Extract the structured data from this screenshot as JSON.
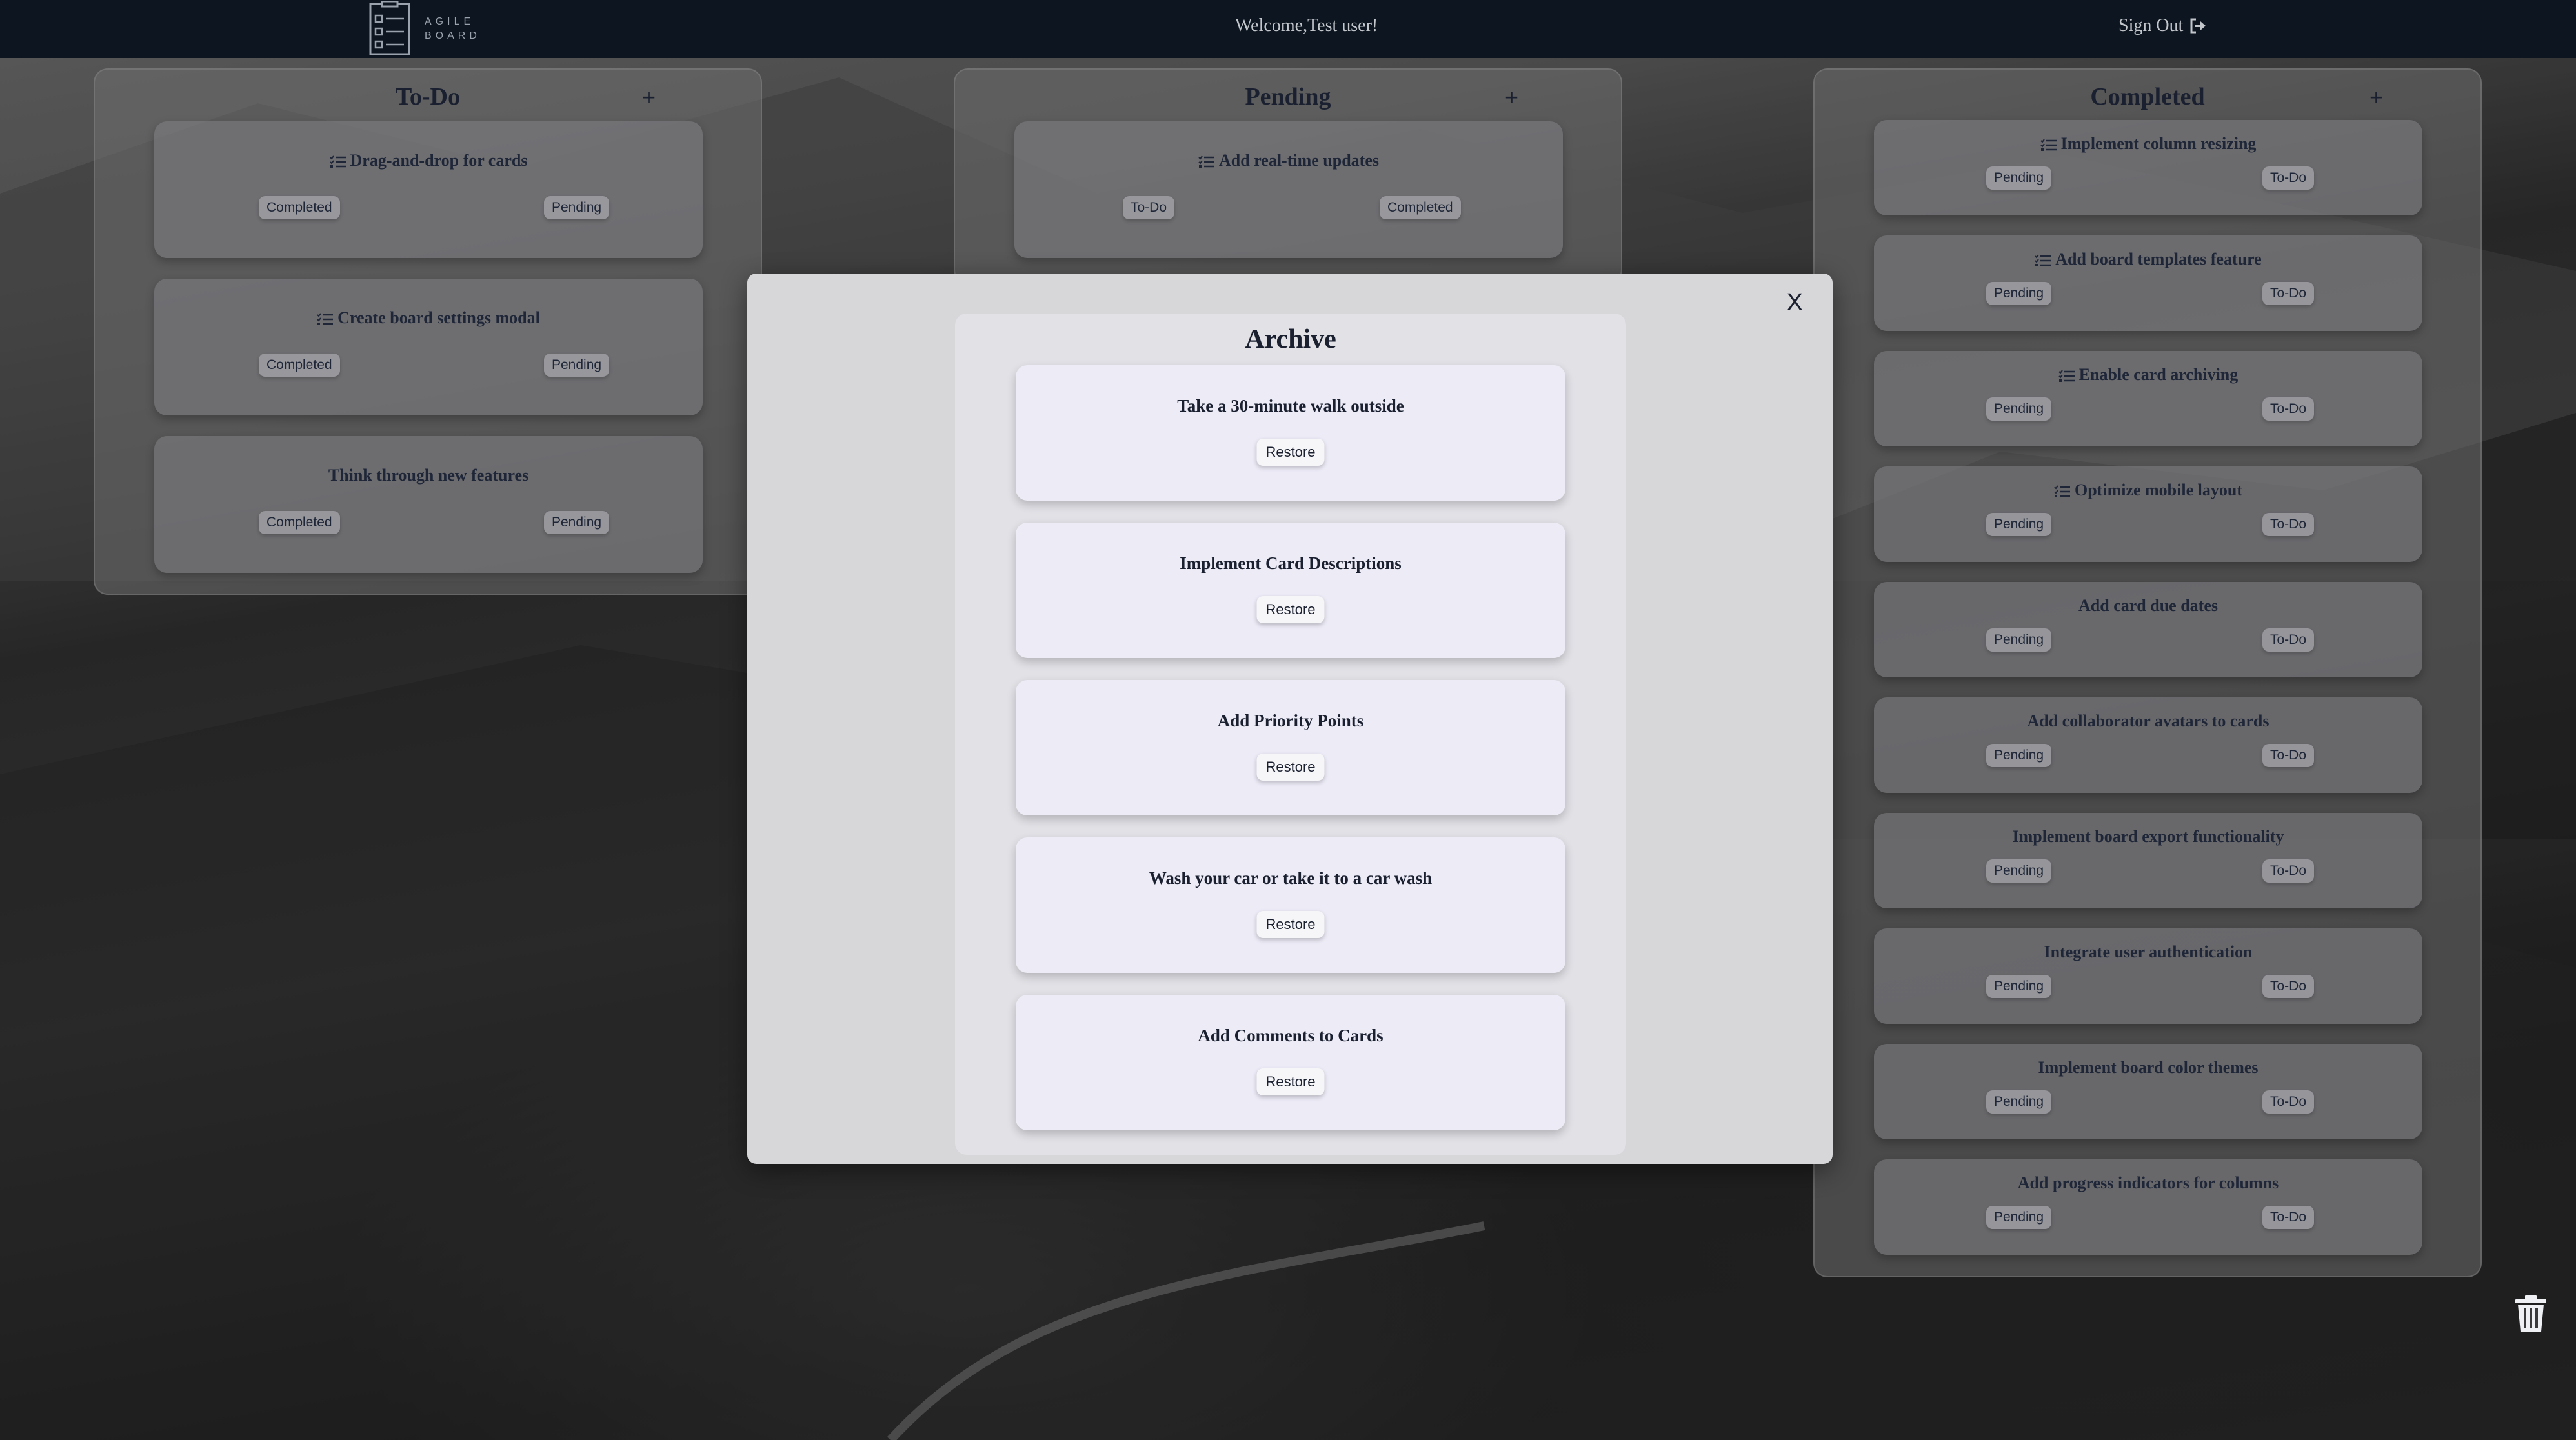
{
  "nav": {
    "logo_line1": "AGILE",
    "logo_line2": "BOARD",
    "welcome": "Welcome,Test user!",
    "signout": "Sign Out"
  },
  "columns": [
    {
      "title": "To-Do",
      "add": "+",
      "cards": [
        {
          "title": "Drag-and-drop for cards",
          "has_list_icon": true,
          "left": "Completed",
          "right": "Pending"
        },
        {
          "title": "Create board settings modal",
          "has_list_icon": true,
          "left": "Completed",
          "right": "Pending"
        },
        {
          "title": "Think through new features",
          "has_list_icon": false,
          "left": "Completed",
          "right": "Pending"
        }
      ]
    },
    {
      "title": "Pending",
      "add": "+",
      "cards": [
        {
          "title": "Add real-time updates",
          "has_list_icon": true,
          "left": "To-Do",
          "right": "Completed"
        }
      ]
    },
    {
      "title": "Completed",
      "add": "+",
      "cards": [
        {
          "title": "Implement column resizing",
          "has_list_icon": true,
          "left": "Pending",
          "right": "To-Do"
        },
        {
          "title": "Add board templates feature",
          "has_list_icon": true,
          "left": "Pending",
          "right": "To-Do"
        },
        {
          "title": "Enable card archiving",
          "has_list_icon": true,
          "left": "Pending",
          "right": "To-Do"
        },
        {
          "title": "Optimize mobile layout",
          "has_list_icon": true,
          "left": "Pending",
          "right": "To-Do"
        },
        {
          "title": "Add card due dates",
          "has_list_icon": false,
          "left": "Pending",
          "right": "To-Do"
        },
        {
          "title": "Add collaborator avatars to cards",
          "has_list_icon": false,
          "left": "Pending",
          "right": "To-Do"
        },
        {
          "title": "Implement board export functionality",
          "has_list_icon": false,
          "left": "Pending",
          "right": "To-Do"
        },
        {
          "title": "Integrate user authentication",
          "has_list_icon": false,
          "left": "Pending",
          "right": "To-Do"
        },
        {
          "title": "Implement board color themes",
          "has_list_icon": false,
          "left": "Pending",
          "right": "To-Do"
        },
        {
          "title": "Add progress indicators for columns",
          "has_list_icon": false,
          "left": "Pending",
          "right": "To-Do"
        }
      ]
    }
  ],
  "modal": {
    "close": "X",
    "title": "Archive",
    "restore_label": "Restore",
    "items": [
      {
        "title": "Take a 30-minute walk outside"
      },
      {
        "title": "Implement Card Descriptions"
      },
      {
        "title": "Add Priority Points"
      },
      {
        "title": "Wash your car or take it to a car wash"
      },
      {
        "title": "Add Comments to Cards"
      }
    ]
  },
  "icons": {
    "logo": "board-logo-icon",
    "signout": "sign-out-icon",
    "card_list": "list-icon",
    "trash": "trash-icon"
  }
}
